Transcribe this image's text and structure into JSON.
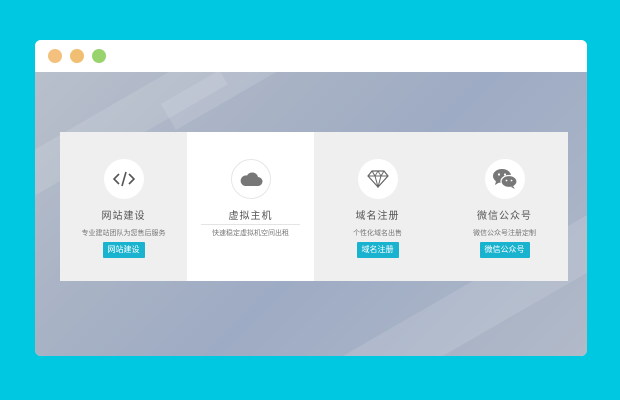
{
  "window": {
    "controls": [
      "close",
      "minimize",
      "maximize"
    ]
  },
  "colors": {
    "page_background": "#00c8e1",
    "accent": "#1ab3cf",
    "card_background": "#efefef",
    "active_card_background": "#ffffff"
  },
  "cards": [
    {
      "icon": "code-icon",
      "title": "网站建设",
      "description": "专业建站团队为您售后服务",
      "button": "网站建设",
      "active": false
    },
    {
      "icon": "cloud-icon",
      "title": "虚拟主机",
      "description": "快速稳定虚拟机空间出租",
      "button": "",
      "active": true
    },
    {
      "icon": "diamond-icon",
      "title": "域名注册",
      "description": "个性化域名出售",
      "button": "域名注册",
      "active": false
    },
    {
      "icon": "wechat-icon",
      "title": "微信公众号",
      "description": "微信公众号注册定制",
      "button": "微信公众号",
      "active": false
    }
  ]
}
